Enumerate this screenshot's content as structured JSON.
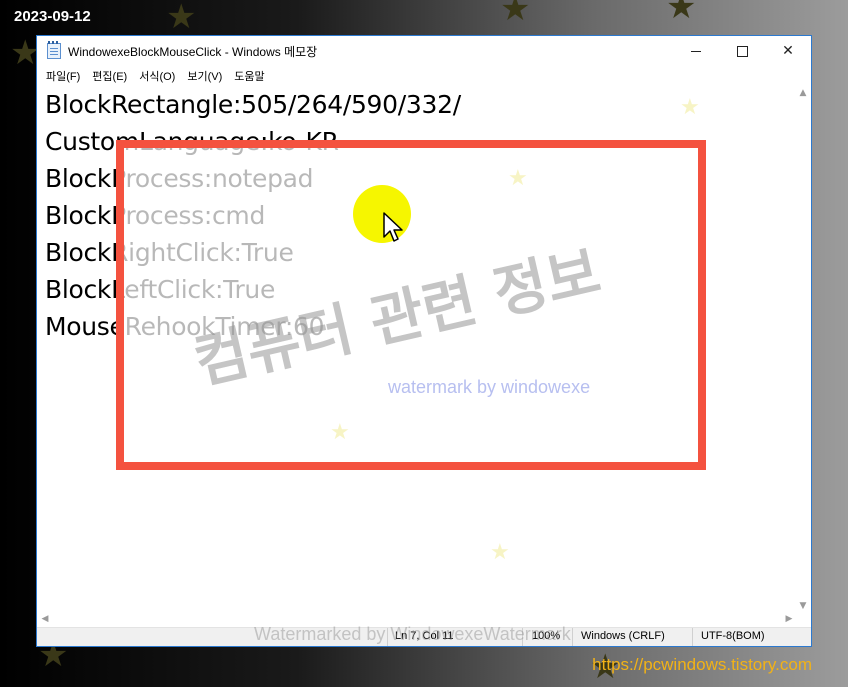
{
  "overlay": {
    "date": "2023-09-12",
    "site_url": "https://pcwindows.tistory.com",
    "watermark_korean": "컴퓨터 관련 정보",
    "watermark_sub": "watermark by windowexe",
    "watermark_bottom": "Watermarked by WindowexeWatermark"
  },
  "window": {
    "title": "WindowexeBlockMouseClick - Windows 메모장",
    "buttons": {
      "minimize": "–",
      "maximize": "☐",
      "close": "✕"
    }
  },
  "menu": [
    "파일(F)",
    "편집(E)",
    "서식(O)",
    "보기(V)",
    "도움말"
  ],
  "editor": {
    "lines": [
      "BlockRectangle:505/264/590/332/",
      "CustomLanguage:ko-KR",
      "BlockProcess:notepad",
      "BlockProcess:cmd",
      "BlockRightClick:True",
      "BlockLeftClick:True",
      "MouseRehookTimer:60"
    ]
  },
  "status": {
    "position": "Ln 7, Col 11",
    "zoom": "100%",
    "line_ending": "Windows (CRLF)",
    "encoding": "UTF-8(BOM)"
  },
  "colors": {
    "block_rectangle_border": "#f4523f",
    "cursor_highlight": "#f6f600",
    "titlebar_border": "#2b79d0"
  }
}
